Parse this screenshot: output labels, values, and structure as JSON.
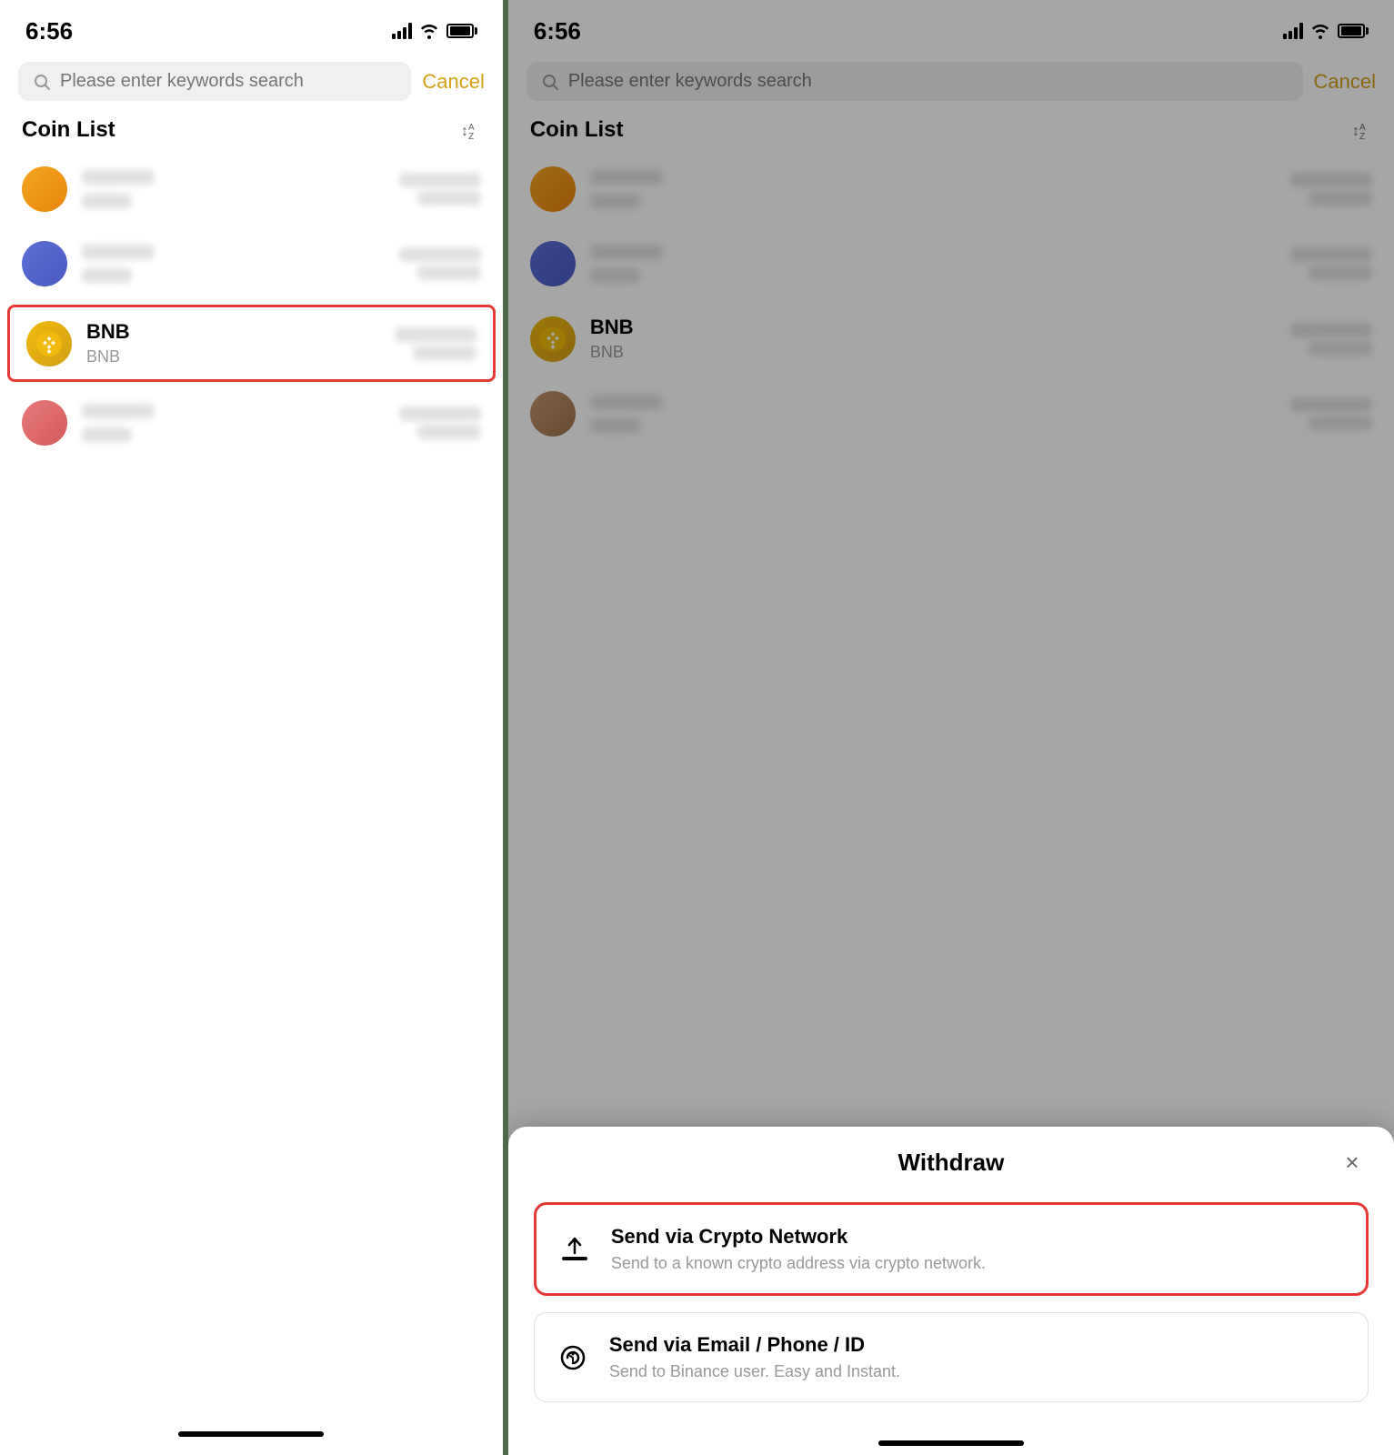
{
  "left": {
    "status": {
      "time": "6:56"
    },
    "search": {
      "placeholder": "Please enter keywords search",
      "cancel_label": "Cancel"
    },
    "coin_list": {
      "title": "Coin List",
      "coins": [
        {
          "id": "coin1",
          "icon_type": "orange",
          "name_blurred": true,
          "ticker_blurred": true
        },
        {
          "id": "coin2",
          "icon_type": "blue",
          "name_blurred": true,
          "ticker_blurred": true
        },
        {
          "id": "bnb",
          "icon_type": "gold",
          "name": "BNB",
          "ticker": "BNB",
          "selected": true
        },
        {
          "id": "coin4",
          "icon_type": "pink",
          "name_blurred": true,
          "ticker_blurred": true
        }
      ]
    }
  },
  "right": {
    "status": {
      "time": "6:56"
    },
    "search": {
      "placeholder": "Please enter keywords search",
      "cancel_label": "Cancel"
    },
    "coin_list": {
      "title": "Coin List",
      "coins": [
        {
          "id": "coin1",
          "icon_type": "orange",
          "name_blurred": true,
          "ticker_blurred": true
        },
        {
          "id": "coin2",
          "icon_type": "blue",
          "name_blurred": true,
          "ticker_blurred": true
        },
        {
          "id": "bnb",
          "icon_type": "gold",
          "name": "BNB",
          "ticker": "BNB"
        },
        {
          "id": "coin4",
          "icon_type": "brown",
          "name_blurred": true,
          "ticker_blurred": true
        }
      ]
    },
    "bottom_sheet": {
      "title": "Withdraw",
      "close_label": "×",
      "options": [
        {
          "id": "crypto-network",
          "title": "Send via Crypto Network",
          "description": "Send to a known crypto address via crypto network.",
          "highlighted": true
        },
        {
          "id": "email-phone",
          "title": "Send via Email / Phone / ID",
          "description": "Send to Binance user. Easy and Instant.",
          "highlighted": false
        }
      ]
    }
  }
}
